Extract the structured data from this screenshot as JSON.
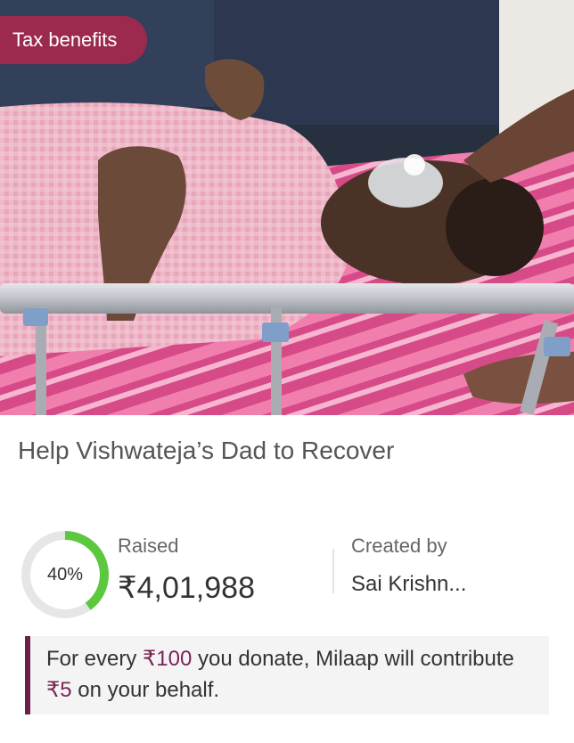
{
  "campaign": {
    "badge_label": "Tax benefits",
    "image_alt": "Patient on hospital bed with oxygen mask",
    "title": "Help Vishwateja’s Dad to Recover"
  },
  "progress": {
    "percent_label": "40%",
    "percent_value": 40,
    "raised_label": "Raised",
    "raised_amount": "₹4,01,988",
    "ring_color": "#5cc83e",
    "ring_track_color": "#e6e6e6"
  },
  "creator": {
    "label": "Created by",
    "name": "Sai Krishn..."
  },
  "contribution_note": {
    "prefix": "For every ",
    "amount_1": "₹100",
    "middle": " you donate, Milaap will contribute ",
    "amount_2": "₹5",
    "suffix": " on your behalf.",
    "accent_color": "#7a2556",
    "border_color": "#6d1f4a"
  },
  "colors": {
    "badge_bg": "#9b2a4e",
    "title_text": "#555555"
  }
}
